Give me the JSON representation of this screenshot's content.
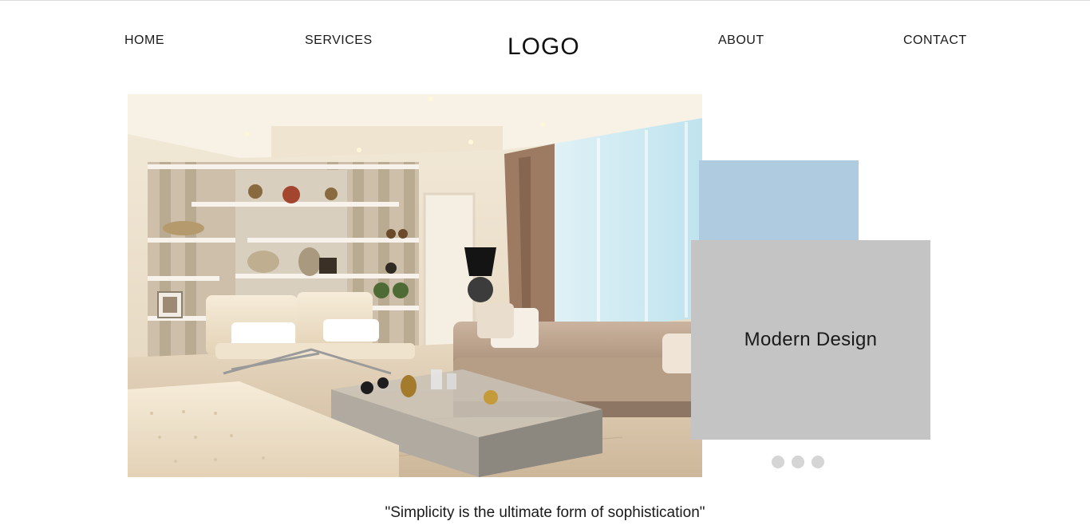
{
  "nav": {
    "home": "HOME",
    "services": "SERVICES",
    "logo": "LOGO",
    "about": "ABOUT",
    "contact": "CONTACT"
  },
  "slider": {
    "card_title": "Modern Design",
    "dots": 3
  },
  "quote": "\"Simplicity is the ultimate form of sophistication\"",
  "colors": {
    "accent_blue": "#afcbe0",
    "card_gray": "#c4c4c4",
    "dot_gray": "#d5d5d5"
  }
}
